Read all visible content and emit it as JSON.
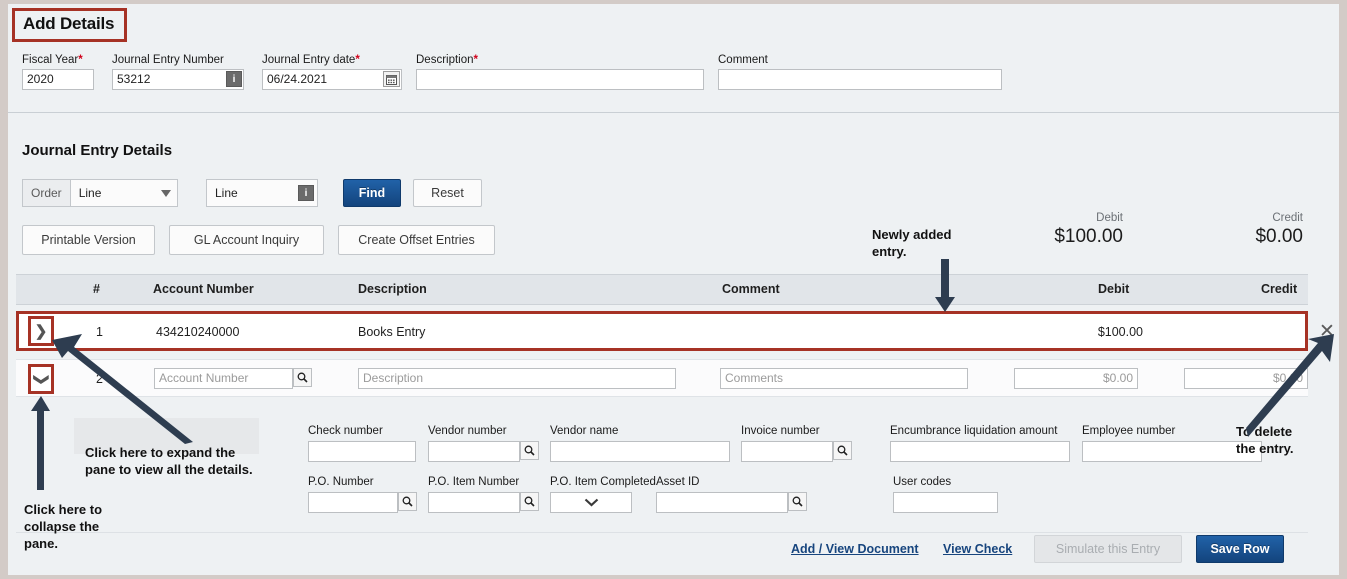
{
  "title": "Add Details",
  "header_form": {
    "fields": [
      {
        "label": "Fiscal Year",
        "required": "*",
        "value": "2020"
      },
      {
        "label": "Journal Entry Number",
        "required": "",
        "value": "53212",
        "addon": "info-icon"
      },
      {
        "label": "Journal Entry date",
        "required": "*",
        "value": "06/24.2021",
        "addon": "calendar-icon"
      },
      {
        "label": "Description",
        "required": "*",
        "value": ""
      },
      {
        "label": "Comment",
        "required": "",
        "value": ""
      }
    ]
  },
  "section": {
    "heading": "Journal Entry Details",
    "order_label": "Order",
    "order_value": "Line",
    "find_field_value": "Line",
    "find_button": "Find",
    "reset_button": "Reset",
    "printable_version": "Printable Version",
    "gl_account_inquiry": "GL Account Inquiry",
    "create_offset_entries": "Create Offset Entries"
  },
  "totals": {
    "debit_label": "Debit",
    "debit_value": "$100.00",
    "credit_label": "Credit",
    "credit_value": "$0.00"
  },
  "grid": {
    "columns": [
      "#",
      "Account Number",
      "Description",
      "Comment",
      "Debit",
      "Credit"
    ],
    "rows": [
      {
        "num": "1",
        "account_number": "434210240000",
        "description": "Books Entry",
        "comment": "",
        "debit": "$100.00",
        "credit": "",
        "expander": "chevron-right",
        "highlighted": true
      },
      {
        "num": "2",
        "account_number_placeholder": "Account Number",
        "description_placeholder": "Description",
        "comment_placeholder": "Comments",
        "debit_placeholder": "$0.00",
        "credit_placeholder": "$0.00",
        "expander": "chevron-down",
        "highlighted": false
      }
    ]
  },
  "detail_pane": {
    "fields": [
      {
        "label": "Check number",
        "value": "",
        "search": false
      },
      {
        "label": "Vendor number",
        "value": "",
        "search": true
      },
      {
        "label": "Vendor name",
        "value": "",
        "search": false
      },
      {
        "label": "Invoice number",
        "value": "",
        "search": true
      },
      {
        "label": "Encumbrance liquidation amount",
        "value": "",
        "search": false
      },
      {
        "label": "Employee number",
        "value": "",
        "search": false
      },
      {
        "label": "P.O. Number",
        "value": "",
        "search": true
      },
      {
        "label": "P.O. Item Number",
        "value": "",
        "search": true
      },
      {
        "label": "P.O. Item Completed",
        "value": "",
        "dropdown": true
      },
      {
        "label": "Asset ID",
        "value": "",
        "search": true
      },
      {
        "label": "User codes",
        "value": "",
        "search": false
      }
    ],
    "actions": {
      "add_view_document": "Add / View Document",
      "view_check": "View Check",
      "simulate_this_entry": "Simulate this Entry",
      "save_row": "Save Row"
    }
  },
  "annotations": [
    {
      "id": "newly-added",
      "text": "Newly added entry."
    },
    {
      "id": "expand-pane",
      "text": "Click here to expand the pane to view all the details."
    },
    {
      "id": "collapse-pane",
      "text": "Click here to collapse the pane."
    },
    {
      "id": "delete-entry",
      "text": "To delete the entry."
    }
  ],
  "annotation_lines": {
    "newly_added_1": "Newly added",
    "newly_added_2": "entry.",
    "expand_1": "Click here to expand the",
    "expand_2": "pane to view all the details.",
    "collapse_1": "Click here to",
    "collapse_2": "collapse the",
    "collapse_3": "pane.",
    "delete_1": "To delete",
    "delete_2": "the entry."
  },
  "colors": {
    "highlight": "#a63225",
    "primary": "#13447d",
    "page_bg": "#eef1f3",
    "annotation": "#2e3d50"
  }
}
